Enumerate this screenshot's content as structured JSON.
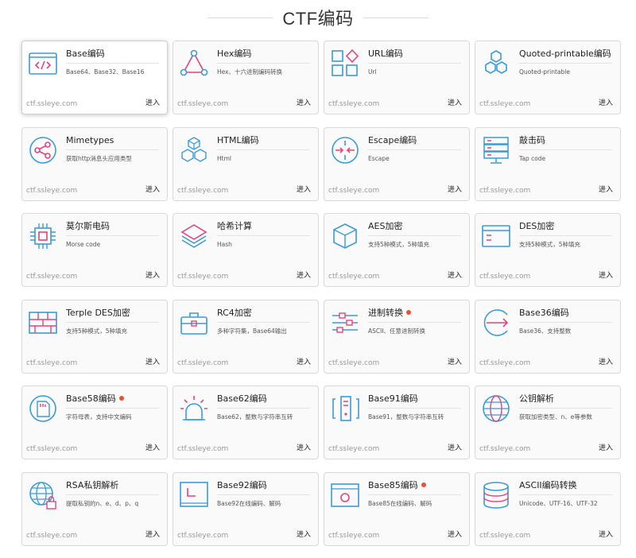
{
  "page": {
    "title": "CTF编码"
  },
  "colors": {
    "icon_blue": "#3b9bd6",
    "icon_pink": "#e0457b",
    "dot_red": "#e8522f"
  },
  "cards": [
    {
      "name": "Base编码",
      "desc": "Base64、Base32、Base16",
      "domain": "ctf.ssleye.com",
      "enter": "进入",
      "icon": "code-window-icon",
      "dot": false
    },
    {
      "name": "Hex编码",
      "desc": "Hex、十六进制编码转换",
      "domain": "ctf.ssleye.com",
      "enter": "进入",
      "icon": "triangle-nodes-icon",
      "dot": false
    },
    {
      "name": "URL编码",
      "desc": "Url",
      "domain": "ctf.ssleye.com",
      "enter": "进入",
      "icon": "squares-diamond-icon",
      "dot": false
    },
    {
      "name": "Quoted-printable编码",
      "desc": "Quoted-printable",
      "domain": "ctf.ssleye.com",
      "enter": "进入",
      "icon": "hexagons-icon",
      "dot": false
    },
    {
      "name": "Mimetypes",
      "desc": "获取http消息头应用类型",
      "domain": "ctf.ssleye.com",
      "enter": "进入",
      "icon": "share-circle-icon",
      "dot": false
    },
    {
      "name": "HTML编码",
      "desc": "Html",
      "domain": "ctf.ssleye.com",
      "enter": "进入",
      "icon": "cubes-icon",
      "dot": false
    },
    {
      "name": "Escape编码",
      "desc": "Escape",
      "domain": "ctf.ssleye.com",
      "enter": "进入",
      "icon": "arrows-in-circle-icon",
      "dot": false
    },
    {
      "name": "敲击码",
      "desc": "Tap code",
      "domain": "ctf.ssleye.com",
      "enter": "进入",
      "icon": "server-rack-icon",
      "dot": false
    },
    {
      "name": "莫尔斯电码",
      "desc": "Morse code",
      "domain": "ctf.ssleye.com",
      "enter": "进入",
      "icon": "chip-icon",
      "dot": false
    },
    {
      "name": "哈希计算",
      "desc": "Hash",
      "domain": "ctf.ssleye.com",
      "enter": "进入",
      "icon": "layers-icon",
      "dot": false
    },
    {
      "name": "AES加密",
      "desc": "支持5种模式，5种填充",
      "domain": "ctf.ssleye.com",
      "enter": "进入",
      "icon": "box-3d-icon",
      "dot": false
    },
    {
      "name": "DES加密",
      "desc": "支持5种模式，5种填充",
      "domain": "ctf.ssleye.com",
      "enter": "进入",
      "icon": "card-window-icon",
      "dot": false
    },
    {
      "name": "Terple DES加密",
      "desc": "支持5种模式，5种填充",
      "domain": "ctf.ssleye.com",
      "enter": "进入",
      "icon": "brick-wall-icon",
      "dot": false
    },
    {
      "name": "RC4加密",
      "desc": "多种字符集，Base64输出",
      "domain": "ctf.ssleye.com",
      "enter": "进入",
      "icon": "toolbox-icon",
      "dot": false
    },
    {
      "name": "进制转换",
      "desc": "ASCII、任意进制转换",
      "domain": "ctf.ssleye.com",
      "enter": "进入",
      "icon": "sliders-icon",
      "dot": true
    },
    {
      "name": "Base36编码",
      "desc": "Base36、支持整数",
      "domain": "ctf.ssleye.com",
      "enter": "进入",
      "icon": "circle-arrow-icon",
      "dot": false
    },
    {
      "name": "Base58编码",
      "desc": "字符母表，支持中文编码",
      "domain": "ctf.ssleye.com",
      "enter": "进入",
      "icon": "sd-card-icon",
      "dot": true
    },
    {
      "name": "Base62编码",
      "desc": "Base62，整数与字符串互转",
      "domain": "ctf.ssleye.com",
      "enter": "进入",
      "icon": "alarm-light-icon",
      "dot": false
    },
    {
      "name": "Base91编码",
      "desc": "Base91，整数与字符串互转",
      "domain": "ctf.ssleye.com",
      "enter": "进入",
      "icon": "tower-brackets-icon",
      "dot": false
    },
    {
      "name": "公钥解析",
      "desc": "获取加密类型、n、e等参数",
      "domain": "ctf.ssleye.com",
      "enter": "进入",
      "icon": "globe-icon",
      "dot": false
    },
    {
      "name": "RSA私钥解析",
      "desc": "提取私钥的n、e、d、p、q",
      "domain": "ctf.ssleye.com",
      "enter": "进入",
      "icon": "globe-lock-icon",
      "dot": false
    },
    {
      "name": "Base92编码",
      "desc": "Base92在线编码、解码",
      "domain": "ctf.ssleye.com",
      "enter": "进入",
      "icon": "clock-square-icon",
      "dot": false
    },
    {
      "name": "Base85编码",
      "desc": "Base85在线编码、解码",
      "domain": "ctf.ssleye.com",
      "enter": "进入",
      "icon": "eye-window-icon",
      "dot": true
    },
    {
      "name": "ASCII编码转换",
      "desc": "Unicode、UTF-16、UTF-32",
      "domain": "ctf.ssleye.com",
      "enter": "进入",
      "icon": "database-icon",
      "dot": false
    }
  ]
}
